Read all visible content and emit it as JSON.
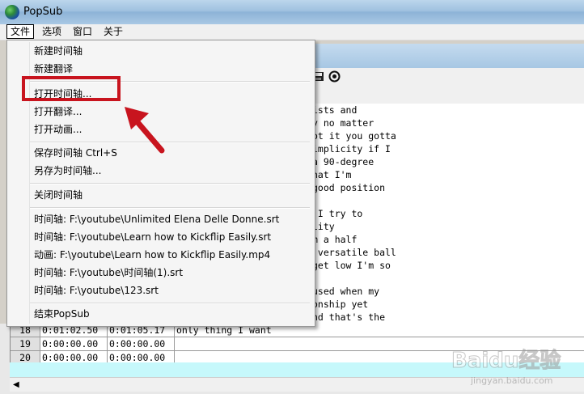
{
  "app": {
    "title": "PopSub"
  },
  "menubar": {
    "items": [
      "文件",
      "选项",
      "窗口",
      "关于"
    ]
  },
  "file_menu": {
    "items": [
      "新建时间轴",
      "新建翻译",
      "打开时间轴...",
      "打开翻译...",
      "打开动画...",
      "保存时间轴 Ctrl+S",
      "另存为时间轴...",
      "关闭时间轴",
      "时间轴: F:\\youtube\\Unlimited Elena Delle Donne.srt",
      "时间轴: F:\\youtube\\Learn how to Kickflip Easily.srt",
      "动画: F:\\youtube\\Learn how to Kickflip Easily.mp4",
      "时间轴: F:\\youtube\\时间轴(1).srt",
      "时间轴: F:\\youtube\\123.srt",
      "结束PopSub"
    ]
  },
  "subtitle_text_lines": [
    "ists and",
    "y no matter",
    "ot it you gotta",
    "implicity if I",
    "a 90-degree",
    "hat I'm",
    "good position",
    "",
    " I try to",
    "lity",
    "m a half",
    " versatile ball",
    "get low I'm so",
    "",
    "used when my",
    "onship yet",
    "nd that's the"
  ],
  "grid_rows": [
    {
      "num": "18",
      "start": "0:01:02.50",
      "end": "0:01:05.17",
      "text": "only thing I want"
    },
    {
      "num": "19",
      "start": "0:00:00.00",
      "end": "0:00:00.00",
      "text": ""
    },
    {
      "num": "20",
      "start": "0:00:00.00",
      "end": "0:00:00.00",
      "text": ""
    }
  ],
  "toolbar_icons": [
    "save-icon",
    "record-icon"
  ],
  "watermark": {
    "text": "Baidu经验",
    "sub": "jingyan.baidu.com"
  },
  "colors": {
    "highlight": "#c8141e",
    "selected_row_band": "#c6f8fb"
  }
}
